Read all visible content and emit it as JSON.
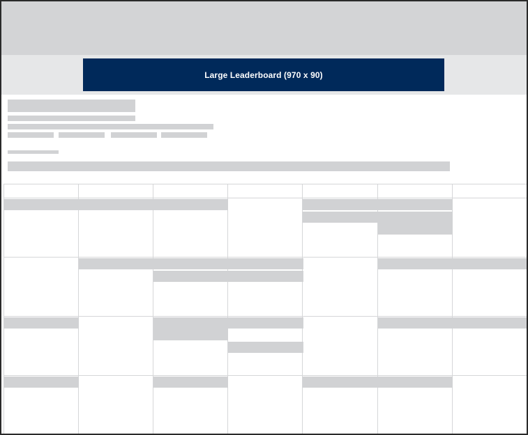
{
  "ad": {
    "label": "Large Leaderboard (970 x 90)",
    "color": "#00295a"
  },
  "placeholder_color": "#d1d2d4",
  "grid_color": "#d5d6d8",
  "frame_color": "#2a2a2a"
}
